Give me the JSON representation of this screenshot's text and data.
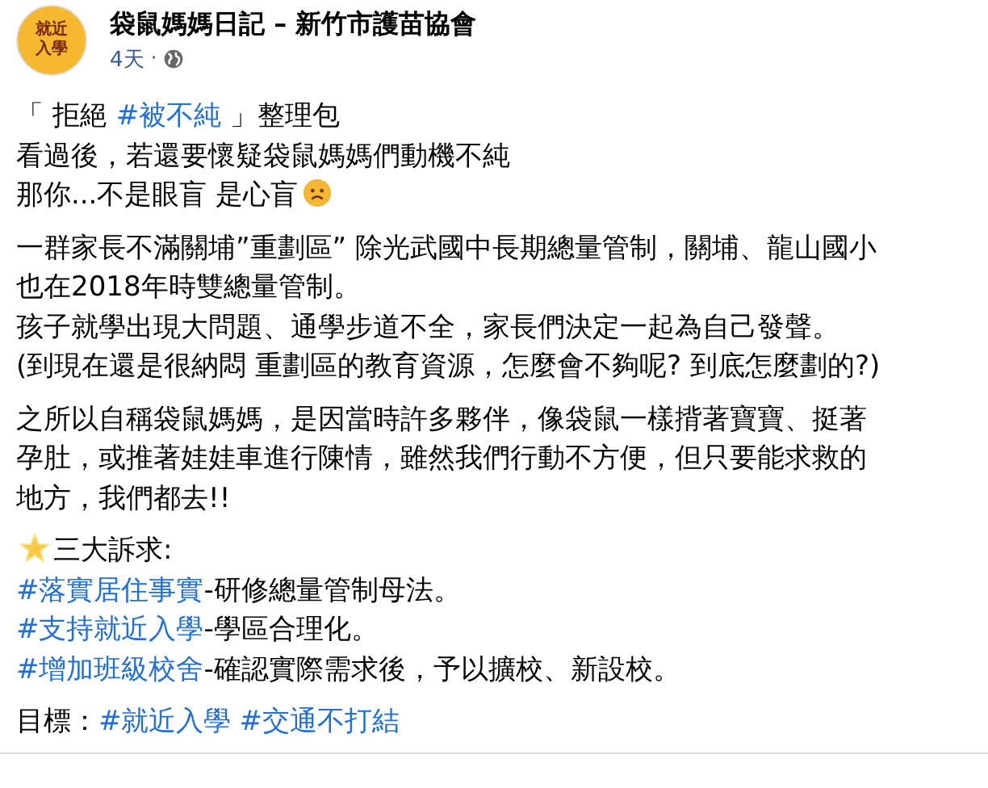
{
  "post": {
    "author": "袋鼠媽媽日記 – 新竹市護苗協會",
    "avatar_text": [
      "就近",
      "入學"
    ],
    "time": "4天",
    "separator": "·",
    "paragraphs": [
      [
        [
          {
            "kind": "text",
            "text": "「 拒絕 "
          },
          {
            "kind": "hashtag",
            "text": "#被不純"
          },
          {
            "kind": "text",
            "text": " 」整理包"
          }
        ],
        [
          {
            "kind": "text",
            "text": "看過後，若還要懷疑袋鼠媽媽們動機不純"
          }
        ],
        [
          {
            "kind": "text",
            "text": "那你...不是眼盲 是心盲"
          },
          {
            "kind": "frown"
          }
        ]
      ],
      [
        [
          {
            "kind": "text",
            "text": "一群家長不滿關埔”重劃區” 除光武國中長期總量管制，關埔、龍山國小"
          }
        ],
        [
          {
            "kind": "text",
            "text": "也在2018年時雙總量管制。"
          }
        ],
        [
          {
            "kind": "text",
            "text": "孩子就學出現大問題、通學步道不全，家長們決定一起為自己發聲。"
          }
        ],
        [
          {
            "kind": "text",
            "text": "(到現在還是很納悶 重劃區的教育資源，怎麼會不夠呢? 到底怎麼劃的?)"
          }
        ]
      ],
      [
        [
          {
            "kind": "text",
            "text": "之所以自稱袋鼠媽媽，是因當時許多夥伴，像袋鼠一樣揹著寶寶、挺著"
          }
        ],
        [
          {
            "kind": "text",
            "text": "孕肚，或推著娃娃車進行陳情，雖然我們行動不方便，但只要能求救的"
          }
        ],
        [
          {
            "kind": "text",
            "text": "地方，我們都去!!"
          }
        ]
      ],
      [
        [
          {
            "kind": "star"
          },
          {
            "kind": "text",
            "text": "三大訴求:"
          }
        ],
        [
          {
            "kind": "hashtag",
            "text": "#落實居住事實"
          },
          {
            "kind": "text",
            "text": "-研修總量管制母法。"
          }
        ],
        [
          {
            "kind": "hashtag",
            "text": "#支持就近入學"
          },
          {
            "kind": "text",
            "text": "-學區合理化。"
          }
        ],
        [
          {
            "kind": "hashtag",
            "text": "#增加班級校舍"
          },
          {
            "kind": "text",
            "text": "-確認實際需求後，予以擴校、新設校。"
          }
        ]
      ],
      [
        [
          {
            "kind": "text",
            "text": "目標："
          },
          {
            "kind": "hashtag",
            "text": "#就近入學"
          },
          {
            "kind": "hashtag",
            "text": "#交通不打結"
          }
        ]
      ]
    ]
  }
}
